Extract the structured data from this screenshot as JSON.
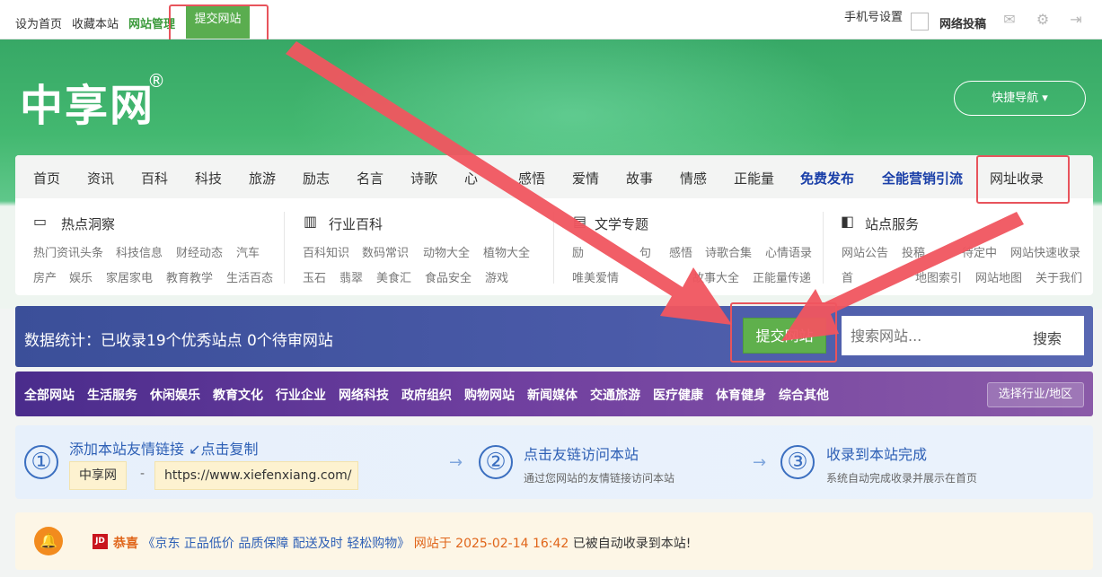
{
  "topbar": {
    "set_home": "设为首页",
    "bookmark": "收藏本站",
    "site_manage": "网站管理",
    "submit_site": "提交网站",
    "phone_settings": "手机号设置",
    "contribute": "网络投稿",
    "icons": [
      "mail-icon",
      "gear-icon",
      "logout-icon"
    ]
  },
  "header": {
    "logo": "中享网",
    "logo_mark": "®",
    "quick_nav": "快捷导航 ▾"
  },
  "nav": {
    "items": [
      "首页",
      "资讯",
      "百科",
      "科技",
      "旅游",
      "励志",
      "名言",
      "诗歌",
      "心",
      "感悟",
      "爱情",
      "故事",
      "情感",
      "正能量"
    ],
    "highlight_items": [
      "免费发布",
      "全能营销引流"
    ],
    "url_collect": "网址收录"
  },
  "categories": [
    {
      "title": "热点洞察",
      "icon": "monitor-icon",
      "row1": [
        "热门资讯头条",
        "科技信息",
        "财经动态",
        "汽车"
      ],
      "row2": [
        "房产",
        "娱乐",
        "家居家电",
        "教育教学",
        "生活百态"
      ]
    },
    {
      "title": "行业百科",
      "icon": "building-icon",
      "row1": [
        "百科知识",
        "数码常识",
        "动物大全",
        "植物大全"
      ],
      "row2": [
        "玉石",
        "翡翠",
        "美食汇",
        "食品安全",
        "游戏"
      ]
    },
    {
      "title": "文学专题",
      "icon": "book-icon",
      "row1": [
        "励",
        "句",
        "感悟",
        "诗歌合集",
        "心情语录"
      ],
      "row2": [
        "唯美爱情",
        "故事大全",
        "正能量传递"
      ]
    },
    {
      "title": "站点服务",
      "icon": "bookmark-icon",
      "row1": [
        "网站公告",
        "投稿",
        "待定中",
        "网站快速收录"
      ],
      "row2": [
        "首",
        "地图索引",
        "网站地图",
        "关于我们"
      ]
    }
  ],
  "stats": {
    "text": "数据统计：已收录19个优秀站点 0个待审网站",
    "submit_button": "提交网站",
    "search_placeholder": "搜索网站...",
    "search_button": "搜索"
  },
  "category_bar": {
    "items": [
      "全部网站",
      "生活服务",
      "休闲娱乐",
      "教育文化",
      "行业企业",
      "网络科技",
      "政府组织",
      "购物网站",
      "新闻媒体",
      "交通旅游",
      "医疗健康",
      "体育健身",
      "综合其他"
    ],
    "region_button": "选择行业/地区"
  },
  "steps": [
    {
      "num": "①",
      "title": "添加本站友情链接 ↙点击复制",
      "chip_name": "中享网",
      "chip_dash": "-",
      "chip_url": "https://www.xiefenxiang.com/"
    },
    {
      "num": "②",
      "title": "点击友链访问本站",
      "sub": "通过您网站的友情链接访问本站"
    },
    {
      "num": "③",
      "title": "收录到本站完成",
      "sub": "系统自动完成收录并展示在首页"
    }
  ],
  "step_arrow": "→",
  "notice": {
    "badge": "JD",
    "congrats": "恭喜",
    "site": "《京东 正品低价 品质保障 配送及时 轻松购物》",
    "tail1": "网站于 2025-02-14 16:42",
    "tail2": "已被自动收录到本站!"
  },
  "colors": {
    "accent_green": "#5fb04c",
    "highlight_red": "#e8545c",
    "stats_blue": "#3b4f99",
    "category_purple": "#6f3f9f"
  }
}
